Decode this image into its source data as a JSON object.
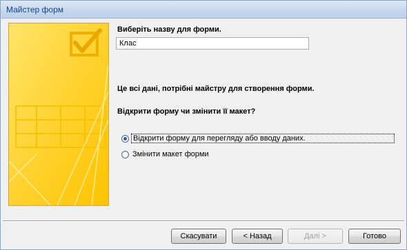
{
  "window": {
    "title": "Майстер форм"
  },
  "form_name": {
    "prompt": "Виберіть назву для форми.",
    "value": "Клас"
  },
  "info_text": "Це всі дані, потрібні майстру для створення форми.",
  "question": "Відкрити форму чи змінити її макет?",
  "options": [
    {
      "label": "Відкрити форму для перегляду або вводу даних.",
      "selected": true
    },
    {
      "label": "Змінити макет форми",
      "selected": false
    }
  ],
  "buttons": {
    "cancel": "Скасувати",
    "back": "< Назад",
    "next": "Далі >",
    "finish": "Готово",
    "next_disabled": true
  },
  "colors": {
    "art_background": "#ffd230",
    "art_accent": "#f5b800",
    "title_text": "#15428b"
  }
}
